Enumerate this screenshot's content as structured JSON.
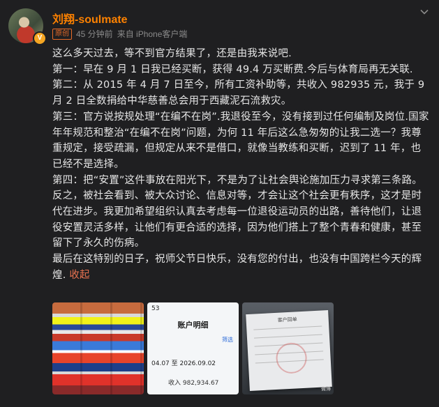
{
  "header": {
    "username": "刘翔-soulmate",
    "verified_badge": "V",
    "original_badge": "原创",
    "time": "45 分钟前",
    "source": "来自 iPhone客户端",
    "menu_icon": "chevron-down-icon"
  },
  "content": {
    "paragraphs": [
      "这么多天过去，等不到官方结果了，还是由我来说吧.",
      "第一：早在 9 月 1 日我已经买断，获得 49.4 万买断费.今后与体育局再无关联.",
      "第二：从 2015 年 4 月 7 日至今，所有工资补助等，共收入 982935 元，我于 9 月 2 日全数捐给中华慈善总会用于西藏泥石流救灾。",
      "第三：官方说按规处理“在编不在岗”.我退役至今，没有接到过任何编制及岗位.国家年年规范和整治“在编不在岗”问题，为何 11 年后这么急匆匆的让我二选一？我尊重规定，接受疏漏，但规定从来不是借口，就像当教练和买断，迟到了 11 年，也已经不是选择。",
      "第四：把“安置”这件事放在阳光下，不是为了让社会舆论施加压力寻求第三条路。反之，被社会看到、被大众讨论、信息对等，才会让这个社会更有秩序，这才是时代在进步。我更加希望组织认真去考虑每一位退役运动员的出路，善待他们，让退役安置灵活多样，让他们有更合适的选择，因为他们搭上了整个青春和健康，甚至留下了永久的伤病。"
    ],
    "last_paragraph": "最后在这特别的日子，祝师父节日快乐，没有您的付出，也没有中国跨栏今天的辉煌.",
    "collapse_label": "收起"
  },
  "images": {
    "ledger": {
      "status": "53",
      "title": "账户明细",
      "filter": "筛选",
      "range": "04.07 至 2026.09.02",
      "income": "收入 982,934.67"
    },
    "receipt": {
      "title": "客户回单"
    },
    "watermark": "微博"
  }
}
